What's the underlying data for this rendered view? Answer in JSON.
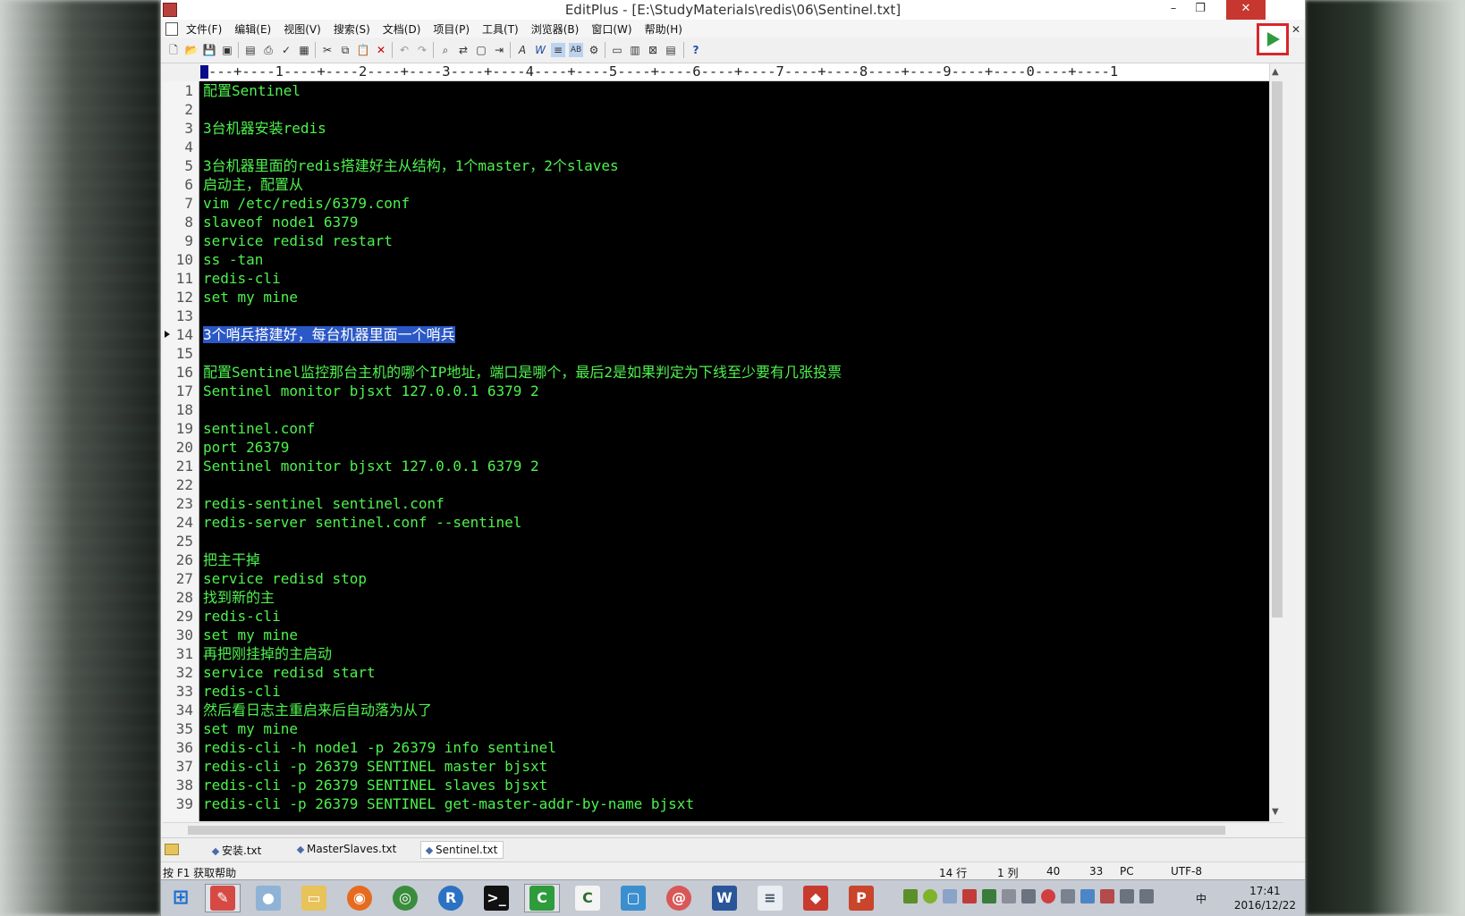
{
  "window": {
    "title": "EditPlus - [E:\\StudyMaterials\\redis\\06\\Sentinel.txt]",
    "minimize": "–",
    "restore": "❐",
    "close": "✕"
  },
  "menu": {
    "items": [
      "文件(F)",
      "编辑(E)",
      "视图(V)",
      "搜索(S)",
      "文档(D)",
      "项目(P)",
      "工具(T)",
      "浏览器(B)",
      "窗口(W)",
      "帮助(H)"
    ]
  },
  "ruler": "---+----1----+----2----+----3----+----4----+----5----+----6----+----7----+----8----+----9----+----0----+----1",
  "editor": {
    "selected_line": 14,
    "lines": [
      "配置Sentinel",
      "",
      "3台机器安装redis",
      "",
      "3台机器里面的redis搭建好主从结构，1个master，2个slaves",
      "启动主，配置从",
      "vim /etc/redis/6379.conf",
      "slaveof node1 6379",
      "service redisd restart",
      "ss -tan",
      "redis-cli",
      "set my mine",
      "",
      "3个哨兵搭建好，每台机器里面一个哨兵",
      "",
      "配置Sentinel监控那台主机的哪个IP地址，端口是哪个，最后2是如果判定为下线至少要有几张投票",
      "Sentinel monitor bjsxt 127.0.0.1 6379 2",
      "",
      "sentinel.conf",
      "port 26379",
      "Sentinel monitor bjsxt 127.0.0.1 6379 2",
      "",
      "redis-sentinel sentinel.conf",
      "redis-server sentinel.conf --sentinel",
      "",
      "把主干掉",
      "service redisd stop",
      "找到新的主",
      "redis-cli",
      "set my mine",
      "再把刚挂掉的主启动",
      "service redisd start",
      "redis-cli",
      "然后看日志主重启来后自动落为从了",
      "set my mine",
      "redis-cli -h node1 -p 26379 info sentinel",
      "redis-cli -p 26379 SENTINEL master bjsxt",
      "redis-cli -p 26379 SENTINEL slaves bjsxt",
      "redis-cli -p 26379 SENTINEL get-master-addr-by-name bjsxt"
    ],
    "line_numbers": [
      "1",
      "2",
      "3",
      "4",
      "5",
      "6",
      "7",
      "8",
      "9",
      "10",
      "11",
      "12",
      "13",
      "14",
      "15",
      "16",
      "17",
      "18",
      "19",
      "20",
      "21",
      "22",
      "23",
      "24",
      "25",
      "26",
      "27",
      "28",
      "29",
      "30",
      "31",
      "32",
      "33",
      "34",
      "35",
      "36",
      "37",
      "38",
      "39"
    ]
  },
  "tabs": [
    "安装.txt",
    "MasterSlaves.txt",
    "Sentinel.txt"
  ],
  "status": {
    "help": "按 F1 获取帮助",
    "row": "14 行",
    "col": "1 列",
    "n1": "40",
    "n2": "33",
    "mode": "PC",
    "encoding": "UTF-8"
  },
  "taskbar": {
    "time": "17:41",
    "date": "2016/12/22",
    "ime": "中"
  },
  "colors": {
    "editor_bg": "#000000",
    "editor_text": "#4ef24e",
    "selection": "#2a58c6",
    "close_button": "#c7372f"
  }
}
